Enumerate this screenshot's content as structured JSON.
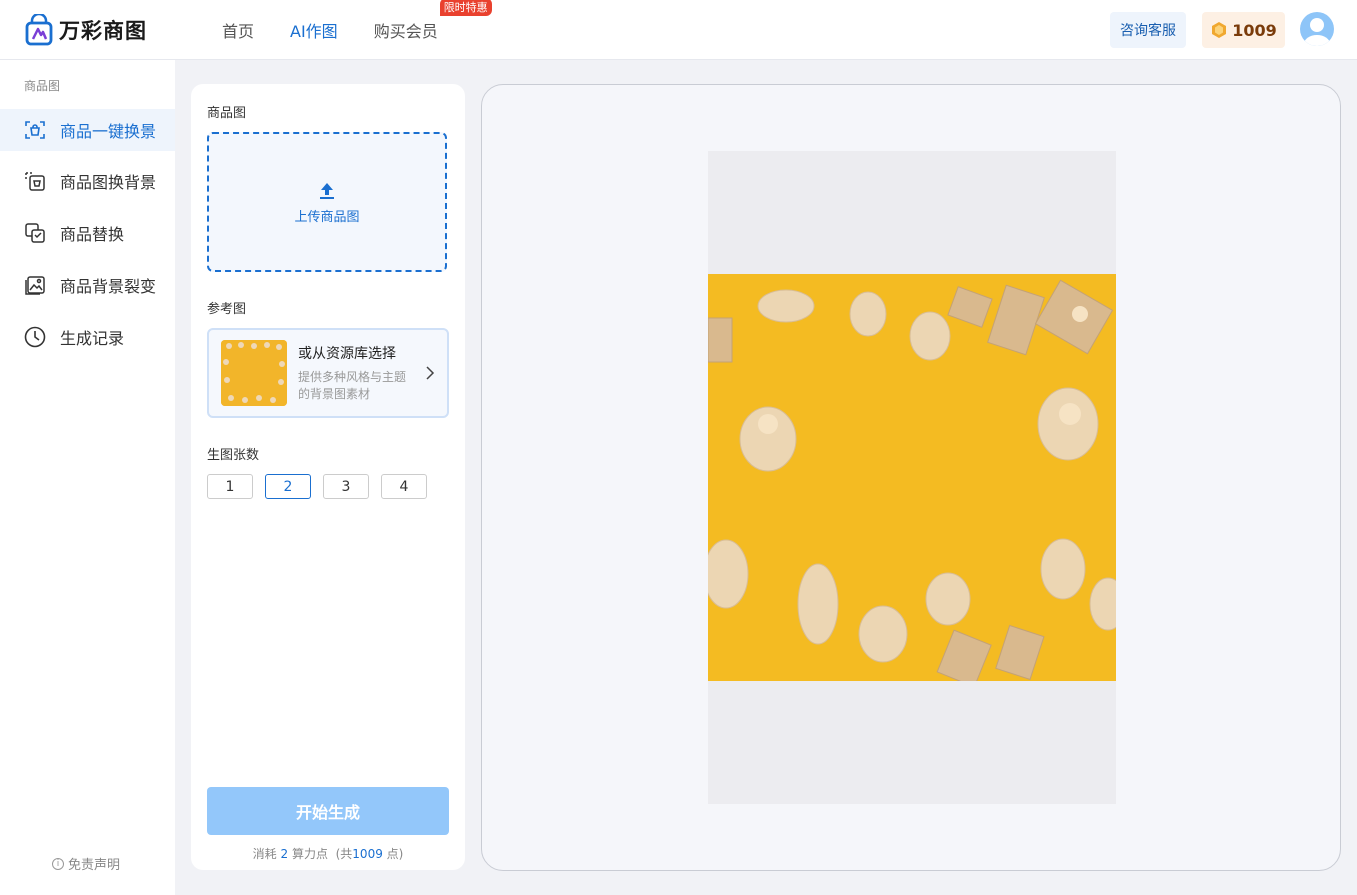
{
  "header": {
    "brand": "万彩商图",
    "nav": [
      {
        "label": "首页"
      },
      {
        "label": "AI作图"
      },
      {
        "label": "购买会员",
        "badge": "限时特惠"
      }
    ],
    "consult_label": "咨询客服",
    "points": "1009"
  },
  "sidebar": {
    "caption": "商品图",
    "items": [
      {
        "label": "商品一键换景",
        "icon": "scan-product-icon",
        "active": true
      },
      {
        "label": "商品图换背景",
        "icon": "swap-background-icon"
      },
      {
        "label": "商品替换",
        "icon": "replace-product-icon"
      },
      {
        "label": "商品背景裂变",
        "icon": "background-variation-icon"
      },
      {
        "label": "生成记录",
        "icon": "clock-icon"
      }
    ],
    "disclaimer": "免责声明"
  },
  "panel": {
    "product_label": "商品图",
    "upload_text": "上传商品图",
    "reference_label": "参考图",
    "reference_title": "或从资源库选择",
    "reference_desc_line1": "提供多种风格与主题",
    "reference_desc_line2": "的背景图素材",
    "count_label": "生图张数",
    "counts": [
      "1",
      "2",
      "3",
      "4"
    ],
    "selected_count": "2",
    "generate_label": "开始生成",
    "cost_prefix": "消耗",
    "cost_value": "2",
    "cost_unit": "算力点",
    "cost_total_prefix": "(共",
    "cost_total": "1009",
    "cost_total_suffix": "点)"
  },
  "colors": {
    "accent": "#1a6fd0",
    "scene_background": "#f4bb22",
    "badge": "#e9412e"
  }
}
